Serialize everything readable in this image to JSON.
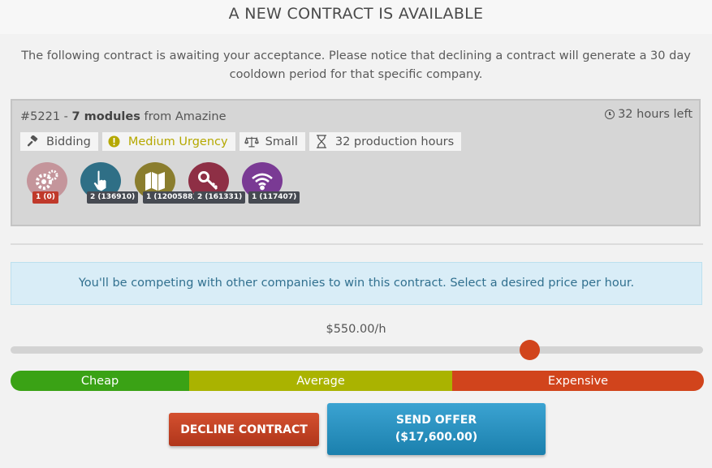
{
  "header": {
    "title": "A NEW CONTRACT IS AVAILABLE"
  },
  "intro": "The following contract is awaiting your acceptance. Please notice that declining a contract will generate a 30 day cooldown period for that specific company.",
  "contract": {
    "id": "#5221",
    "separator": " - ",
    "modules_label": "7 modules",
    "from_label": " from Amazine",
    "time_left": "32 hours left",
    "tags": {
      "type": "Bidding",
      "urgency": "Medium Urgency",
      "size": "Small",
      "hours": "32 production hours"
    },
    "modules": [
      {
        "icon": "gears-icon",
        "badge": "1 (0)",
        "color": "#c4959b"
      },
      {
        "icon": "pointer-hand-icon",
        "badge": "2 (136910)",
        "color": "#2f6f86"
      },
      {
        "icon": "map-icon",
        "badge": "1 (1200588)",
        "color": "#8a7d2e"
      },
      {
        "icon": "key-icon",
        "badge": "2 (161331)",
        "color": "#8e2f45"
      },
      {
        "icon": "wifi-icon",
        "badge": "1 (117407)",
        "color": "#7a3a94"
      }
    ]
  },
  "info_message": "You'll be competing with other companies to win this contract. Select a desired price per hour.",
  "price": {
    "label": "$550.00/h"
  },
  "range": {
    "cheap": "Cheap",
    "average": "Average",
    "expensive": "Expensive"
  },
  "buttons": {
    "decline": "DECLINE CONTRACT",
    "send_line1": "SEND OFFER",
    "send_line2": "($17,600.00)"
  },
  "colors": {
    "accent": "#d1441c",
    "info_bg": "#d9edf7",
    "send": "#2790c0",
    "decline": "#c0432a"
  }
}
